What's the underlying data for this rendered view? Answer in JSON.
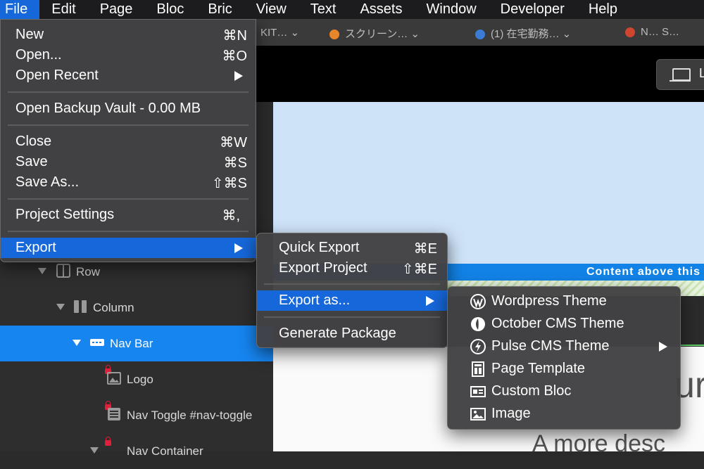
{
  "menubar": {
    "items": [
      "File",
      "Edit",
      "Page",
      "Bloc",
      "Bric",
      "View",
      "Text",
      "Assets",
      "Window",
      "Developer",
      "Help"
    ],
    "active": "File"
  },
  "background": {
    "tabs": [
      "KIT…",
      "スクリーン…",
      "(1) 在宅勤務…",
      "N… S…"
    ],
    "device_button_label": "L",
    "content_bar_text": "Content above this",
    "big_text": "ur",
    "desc_text": "A more desc"
  },
  "tree": {
    "rows": [
      {
        "label": "Row",
        "icon": "row-icon"
      },
      {
        "label": "Column",
        "icon": "column-icon"
      },
      {
        "label": "Nav Bar",
        "icon": "navbar-icon"
      },
      {
        "label": "Logo",
        "icon": "image-icon"
      },
      {
        "label": "Nav Toggle #nav-toggle",
        "icon": "text-block-icon"
      },
      {
        "label": "Nav Container",
        "icon": "container-icon"
      }
    ]
  },
  "file_menu": {
    "new": {
      "label": "New",
      "shortcut": "⌘N"
    },
    "open": {
      "label": "Open...",
      "shortcut": "⌘O"
    },
    "open_recent": {
      "label": "Open Recent"
    },
    "backup": {
      "label": "Open Backup Vault - 0.00 MB"
    },
    "close": {
      "label": "Close",
      "shortcut": "⌘W"
    },
    "save": {
      "label": "Save",
      "shortcut": "⌘S"
    },
    "save_as": {
      "label": "Save As...",
      "shortcut": "⇧⌘S"
    },
    "project_settings": {
      "label": "Project Settings",
      "shortcut": "⌘,"
    },
    "export": {
      "label": "Export"
    }
  },
  "export_menu": {
    "quick_export": {
      "label": "Quick Export",
      "shortcut": "⌘E"
    },
    "export_project": {
      "label": "Export Project",
      "shortcut": "⇧⌘E"
    },
    "export_as": {
      "label": "Export as..."
    },
    "generate_package": {
      "label": "Generate Package"
    }
  },
  "export_as_menu": {
    "wordpress": {
      "label": "Wordpress Theme"
    },
    "october": {
      "label": "October CMS Theme"
    },
    "pulse": {
      "label": "Pulse CMS Theme"
    },
    "page_template": {
      "label": "Page Template"
    },
    "custom_bloc": {
      "label": "Custom Bloc"
    },
    "image": {
      "label": "Image"
    }
  },
  "colors": {
    "menu_highlight": "#1667d9",
    "tree_selection": "#1685f0",
    "canvas_blue": "#cfe3f8",
    "content_bar": "#1283e6"
  }
}
